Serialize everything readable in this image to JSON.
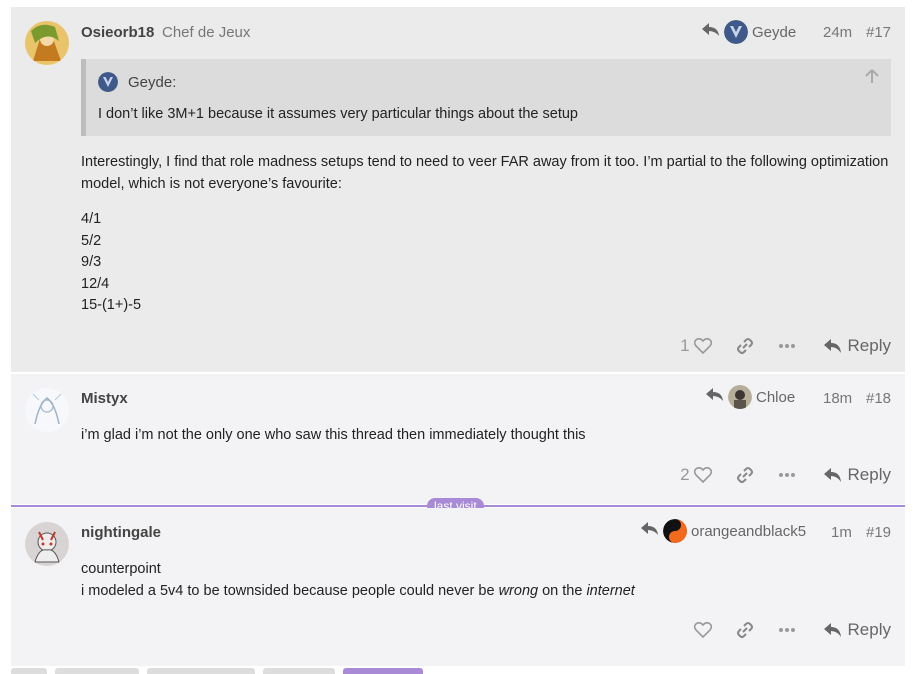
{
  "posts": [
    {
      "username": "Osieorb18",
      "user_title": "Chef de Jeux",
      "reply_to": "Geyde",
      "time": "24m",
      "number": "#17",
      "quote": {
        "author": "Geyde:",
        "text": "I don’t like 3M+1 because it assumes very particular things about the setup"
      },
      "paragraph": "Interestingly, I find that role madness setups tend to need to veer FAR away from it too. I’m partial to the following optimization model, which is not everyone’s favourite:",
      "lines": [
        "4/1",
        "5/2",
        "9/3",
        "12/4",
        "15-(1+)-5"
      ],
      "likes": "1",
      "reply_label": "Reply"
    },
    {
      "username": "Mistyx",
      "reply_to": "Chloe",
      "time": "18m",
      "number": "#18",
      "paragraph": "i’m glad i’m not the only one who saw this thread then immediately thought this",
      "likes": "2",
      "reply_label": "Reply"
    },
    {
      "username": "nightingale",
      "reply_to": "orangeandblack5",
      "time": "1m",
      "number": "#19",
      "line1": "counterpoint",
      "line2_a": "i modeled a 5v4 to be townsided because people could never be ",
      "line2_em1": "wrong",
      "line2_b": " on the ",
      "line2_em2": "internet",
      "likes": "",
      "reply_label": "Reply"
    }
  ],
  "divider": {
    "label": "last visit"
  },
  "colors": {
    "divider": "#a88ad6",
    "post_highlight_bg": "#ebebeb",
    "post_bg": "#f3f3f5"
  },
  "icons": [
    "reply-arrow-icon",
    "heart-icon",
    "link-icon",
    "more-dots-icon",
    "reply-icon",
    "arrow-up-icon"
  ]
}
